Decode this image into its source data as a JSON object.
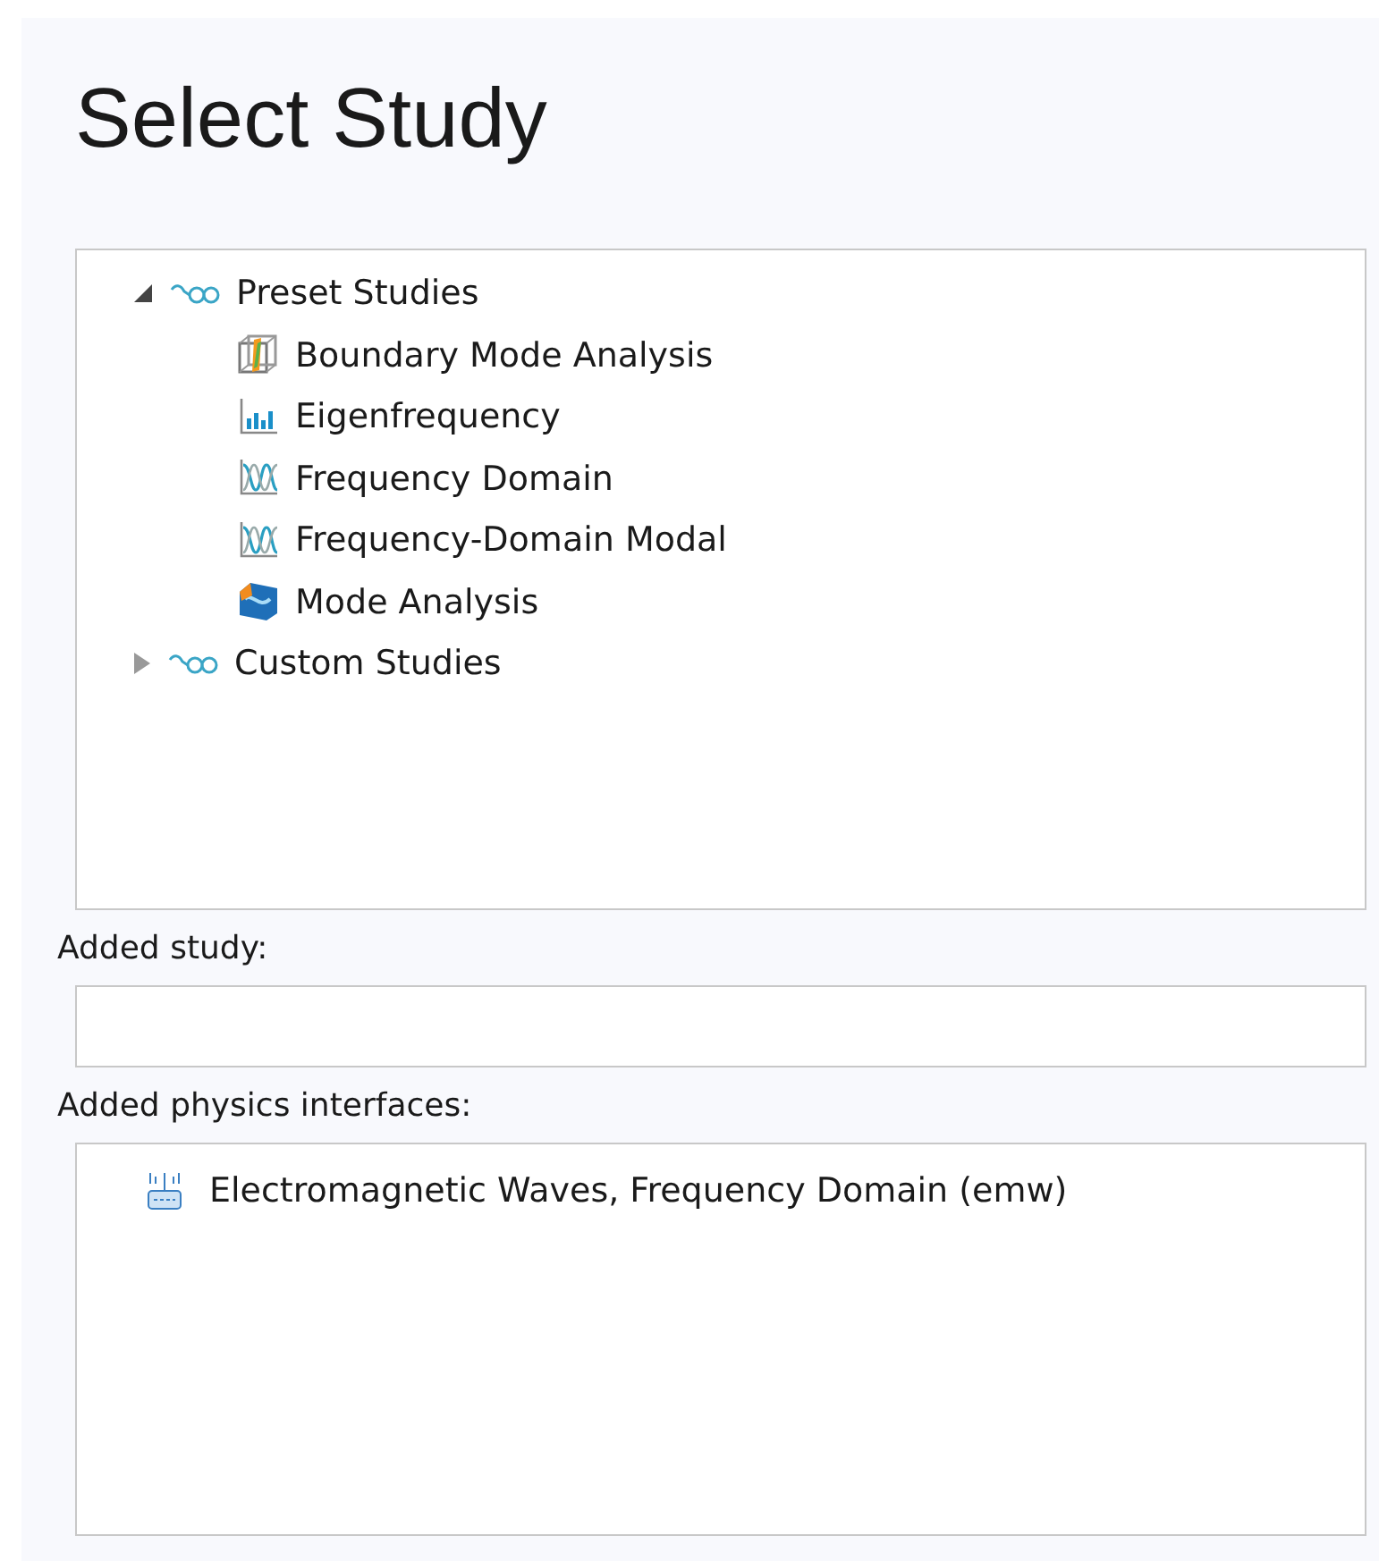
{
  "title": "Select Study",
  "studies": [
    {
      "label": "Preset Studies",
      "expanded": true,
      "children": [
        {
          "label": "Boundary Mode Analysis",
          "kind": "boundary"
        },
        {
          "label": "Eigenfrequency",
          "kind": "eigen"
        },
        {
          "label": "Frequency Domain",
          "kind": "frequency"
        },
        {
          "label": "Frequency-Domain Modal",
          "kind": "frequency"
        },
        {
          "label": "Mode Analysis",
          "kind": "mode"
        }
      ]
    },
    {
      "label": "Custom Studies",
      "expanded": false
    }
  ],
  "added_study": {
    "label": "Added study:"
  },
  "added_physics": {
    "label": "Added physics interfaces:",
    "items": [
      {
        "label": "Electromagnetic Waves, Frequency Domain (emw)"
      }
    ]
  }
}
